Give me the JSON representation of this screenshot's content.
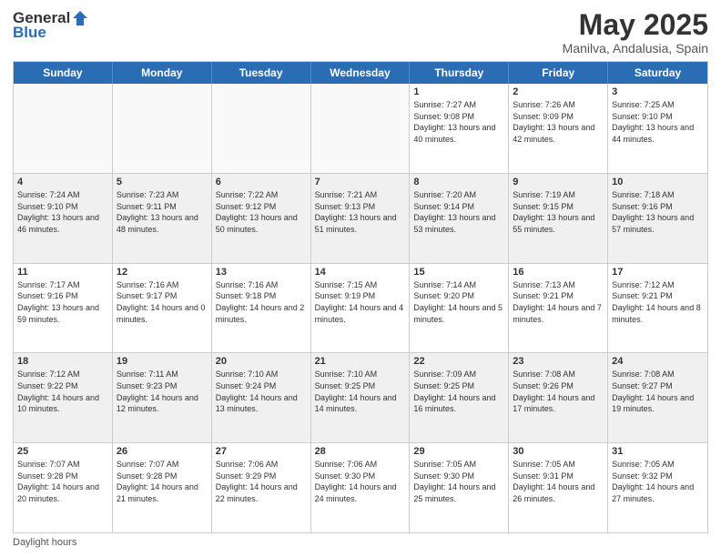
{
  "logo": {
    "general": "General",
    "blue": "Blue"
  },
  "title": "May 2025",
  "subtitle": "Manilva, Andalusia, Spain",
  "days": [
    "Sunday",
    "Monday",
    "Tuesday",
    "Wednesday",
    "Thursday",
    "Friday",
    "Saturday"
  ],
  "weeks": [
    [
      {
        "day": "",
        "info": ""
      },
      {
        "day": "",
        "info": ""
      },
      {
        "day": "",
        "info": ""
      },
      {
        "day": "",
        "info": ""
      },
      {
        "day": "1",
        "info": "Sunrise: 7:27 AM\nSunset: 9:08 PM\nDaylight: 13 hours and 40 minutes."
      },
      {
        "day": "2",
        "info": "Sunrise: 7:26 AM\nSunset: 9:09 PM\nDaylight: 13 hours and 42 minutes."
      },
      {
        "day": "3",
        "info": "Sunrise: 7:25 AM\nSunset: 9:10 PM\nDaylight: 13 hours and 44 minutes."
      }
    ],
    [
      {
        "day": "4",
        "info": "Sunrise: 7:24 AM\nSunset: 9:10 PM\nDaylight: 13 hours and 46 minutes."
      },
      {
        "day": "5",
        "info": "Sunrise: 7:23 AM\nSunset: 9:11 PM\nDaylight: 13 hours and 48 minutes."
      },
      {
        "day": "6",
        "info": "Sunrise: 7:22 AM\nSunset: 9:12 PM\nDaylight: 13 hours and 50 minutes."
      },
      {
        "day": "7",
        "info": "Sunrise: 7:21 AM\nSunset: 9:13 PM\nDaylight: 13 hours and 51 minutes."
      },
      {
        "day": "8",
        "info": "Sunrise: 7:20 AM\nSunset: 9:14 PM\nDaylight: 13 hours and 53 minutes."
      },
      {
        "day": "9",
        "info": "Sunrise: 7:19 AM\nSunset: 9:15 PM\nDaylight: 13 hours and 55 minutes."
      },
      {
        "day": "10",
        "info": "Sunrise: 7:18 AM\nSunset: 9:16 PM\nDaylight: 13 hours and 57 minutes."
      }
    ],
    [
      {
        "day": "11",
        "info": "Sunrise: 7:17 AM\nSunset: 9:16 PM\nDaylight: 13 hours and 59 minutes."
      },
      {
        "day": "12",
        "info": "Sunrise: 7:16 AM\nSunset: 9:17 PM\nDaylight: 14 hours and 0 minutes."
      },
      {
        "day": "13",
        "info": "Sunrise: 7:16 AM\nSunset: 9:18 PM\nDaylight: 14 hours and 2 minutes."
      },
      {
        "day": "14",
        "info": "Sunrise: 7:15 AM\nSunset: 9:19 PM\nDaylight: 14 hours and 4 minutes."
      },
      {
        "day": "15",
        "info": "Sunrise: 7:14 AM\nSunset: 9:20 PM\nDaylight: 14 hours and 5 minutes."
      },
      {
        "day": "16",
        "info": "Sunrise: 7:13 AM\nSunset: 9:21 PM\nDaylight: 14 hours and 7 minutes."
      },
      {
        "day": "17",
        "info": "Sunrise: 7:12 AM\nSunset: 9:21 PM\nDaylight: 14 hours and 8 minutes."
      }
    ],
    [
      {
        "day": "18",
        "info": "Sunrise: 7:12 AM\nSunset: 9:22 PM\nDaylight: 14 hours and 10 minutes."
      },
      {
        "day": "19",
        "info": "Sunrise: 7:11 AM\nSunset: 9:23 PM\nDaylight: 14 hours and 12 minutes."
      },
      {
        "day": "20",
        "info": "Sunrise: 7:10 AM\nSunset: 9:24 PM\nDaylight: 14 hours and 13 minutes."
      },
      {
        "day": "21",
        "info": "Sunrise: 7:10 AM\nSunset: 9:25 PM\nDaylight: 14 hours and 14 minutes."
      },
      {
        "day": "22",
        "info": "Sunrise: 7:09 AM\nSunset: 9:25 PM\nDaylight: 14 hours and 16 minutes."
      },
      {
        "day": "23",
        "info": "Sunrise: 7:08 AM\nSunset: 9:26 PM\nDaylight: 14 hours and 17 minutes."
      },
      {
        "day": "24",
        "info": "Sunrise: 7:08 AM\nSunset: 9:27 PM\nDaylight: 14 hours and 19 minutes."
      }
    ],
    [
      {
        "day": "25",
        "info": "Sunrise: 7:07 AM\nSunset: 9:28 PM\nDaylight: 14 hours and 20 minutes."
      },
      {
        "day": "26",
        "info": "Sunrise: 7:07 AM\nSunset: 9:28 PM\nDaylight: 14 hours and 21 minutes."
      },
      {
        "day": "27",
        "info": "Sunrise: 7:06 AM\nSunset: 9:29 PM\nDaylight: 14 hours and 22 minutes."
      },
      {
        "day": "28",
        "info": "Sunrise: 7:06 AM\nSunset: 9:30 PM\nDaylight: 14 hours and 24 minutes."
      },
      {
        "day": "29",
        "info": "Sunrise: 7:05 AM\nSunset: 9:30 PM\nDaylight: 14 hours and 25 minutes."
      },
      {
        "day": "30",
        "info": "Sunrise: 7:05 AM\nSunset: 9:31 PM\nDaylight: 14 hours and 26 minutes."
      },
      {
        "day": "31",
        "info": "Sunrise: 7:05 AM\nSunset: 9:32 PM\nDaylight: 14 hours and 27 minutes."
      }
    ]
  ],
  "footer": "Daylight hours"
}
